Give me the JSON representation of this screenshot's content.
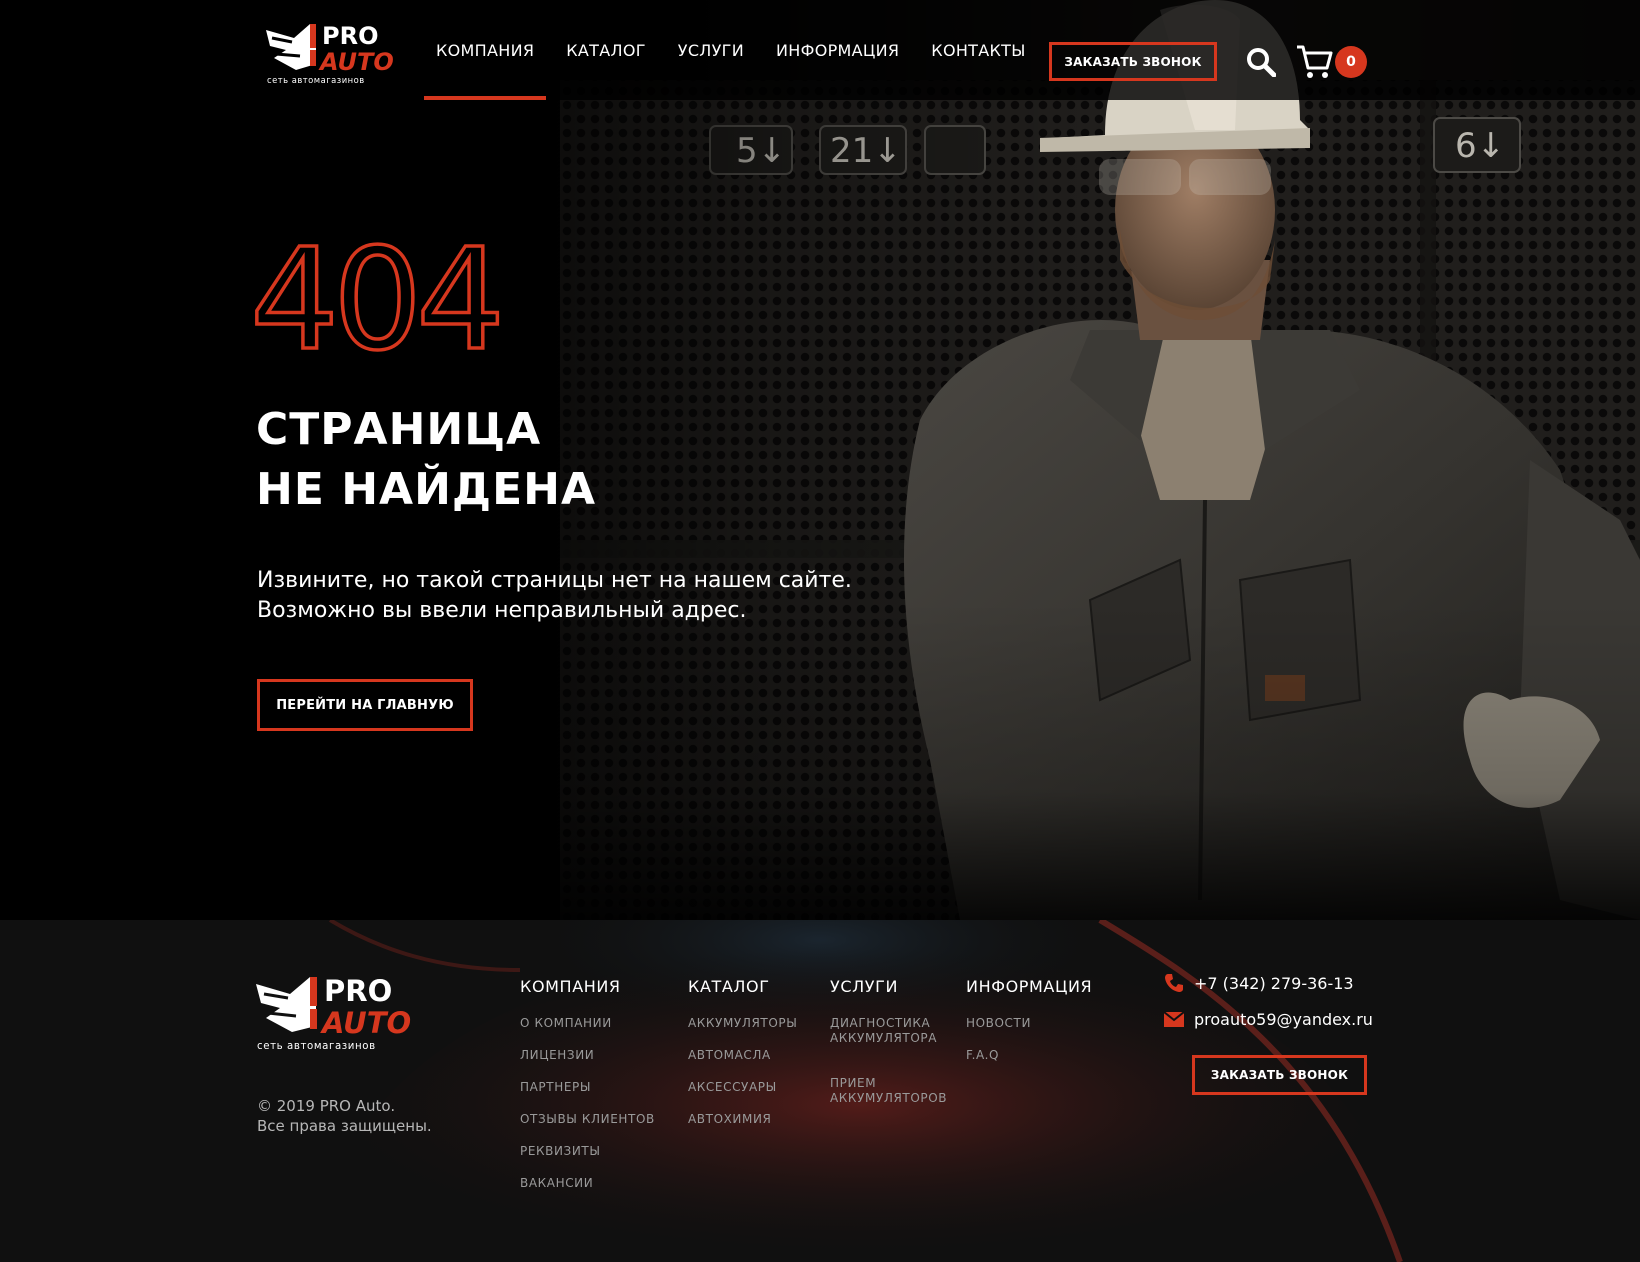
{
  "brand": {
    "logo_text_top": "PRO",
    "logo_text_bottom": "AUTO",
    "logo_tagline": "сеть автомагазинов",
    "accent_color": "#d6371e"
  },
  "header": {
    "nav": [
      {
        "label": "КОМПАНИЯ",
        "active": true
      },
      {
        "label": "КАТАЛОГ"
      },
      {
        "label": "УСЛУГИ"
      },
      {
        "label": "ИНФОРМАЦИЯ"
      },
      {
        "label": "КОНТАКТЫ"
      }
    ],
    "call_button": "ЗАКАЗАТЬ ЗВОНОК",
    "search_icon": "search-icon",
    "cart_icon": "cart-icon",
    "cart_count": "0"
  },
  "hero": {
    "code": "404",
    "title_line1": "СТРАНИЦА",
    "title_line2": "НЕ НАЙДЕНА",
    "text_line1": "Извините, но такой страницы нет на нашем сайте.",
    "text_line2": "Возможно вы ввели неправильный адрес.",
    "home_button": "ПЕРЕЙТИ НА ГЛАВНУЮ"
  },
  "footer": {
    "columns": [
      {
        "title": "КОМПАНИЯ",
        "links": [
          "О КОМПАНИИ",
          "ЛИЦЕНЗИИ",
          "ПАРТНЕРЫ",
          "ОТЗЫВЫ КЛИЕНТОВ",
          "РЕКВИЗИТЫ",
          "ВАКАНСИИ"
        ]
      },
      {
        "title": "КАТАЛОГ",
        "links": [
          "АККУМУЛЯТОРЫ",
          "АВТОМАСЛА",
          "АКСЕССУАРЫ",
          "АВТОХИМИЯ"
        ]
      },
      {
        "title": "УСЛУГИ",
        "links": [
          [
            "ДИАГНОСТИКА",
            "АККУМУЛЯТОРА"
          ],
          [
            "ПРИЕМ",
            "АККУМУЛЯТОРОВ"
          ]
        ]
      },
      {
        "title": "ИНФОРМАЦИЯ",
        "links": [
          "НОВОСТИ",
          "F.A.Q"
        ]
      }
    ],
    "phone": "+7 (342) 279-36-13",
    "email": "proauto59@yandex.ru",
    "call_button": "ЗАКАЗАТЬ ЗВОНОК",
    "copyright_line1": "© 2019 PRO Auto.",
    "copyright_line2": "Все права защищены.",
    "phone_icon": "phone-icon",
    "mail_icon": "mail-icon"
  }
}
